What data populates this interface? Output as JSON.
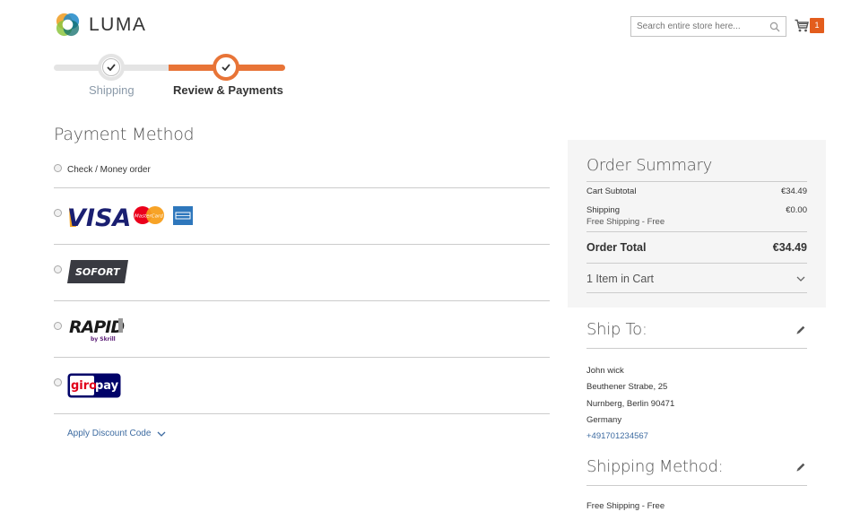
{
  "brand": {
    "name": "LUMA"
  },
  "search": {
    "placeholder": "Search entire store here..."
  },
  "cart": {
    "count": "1"
  },
  "progress": {
    "steps": [
      {
        "label": "Shipping",
        "state": "complete"
      },
      {
        "label": "Review & Payments",
        "state": "active"
      }
    ]
  },
  "payment": {
    "title": "Payment Method",
    "options": [
      {
        "label": "Check / Money order"
      },
      {
        "logo_text": "VISA",
        "extra": "MasterCard",
        "icon": "visa-mastercard-amex-logos"
      },
      {
        "logo_text": "SOFORT",
        "icon": "sofort-logo"
      },
      {
        "logo_text": "RAPID",
        "sub": "by Skrill",
        "icon": "rapid-transfer-logo"
      },
      {
        "logo_text_1": "giro",
        "logo_text_2": "pay",
        "icon": "giropay-logo"
      }
    ],
    "discount_label": "Apply Discount Code"
  },
  "summary": {
    "title": "Order Summary",
    "subtotal_label": "Cart Subtotal",
    "subtotal_value": "€34.49",
    "shipping_label": "Shipping",
    "shipping_value": "€0.00",
    "shipping_note": "Free Shipping - Free",
    "total_label": "Order Total",
    "total_value": "€34.49",
    "items_label": "1 Item in Cart"
  },
  "ship_to": {
    "title": "Ship To:",
    "name": "John wick",
    "street": "Beuthener Strabe, 25",
    "city": "Nurnberg, Berlin 90471",
    "country": "Germany",
    "phone": "+491701234567"
  },
  "shipping_method": {
    "title": "Shipping Method:",
    "value": "Free Shipping - Free"
  },
  "colors": {
    "accent": "#e87437",
    "link": "#3d6ba1",
    "badge": "#e35d1d"
  }
}
